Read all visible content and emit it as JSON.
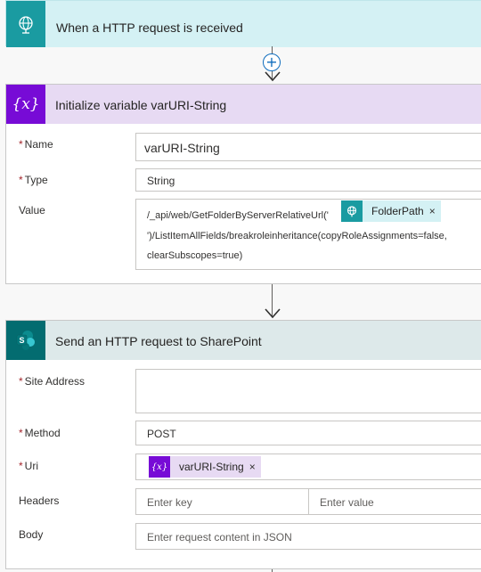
{
  "trigger": {
    "title": "When a HTTP request is received",
    "icon": "globe-request-icon",
    "color": "#1a9ba1"
  },
  "connector_add": {
    "icon": "plus-circle-icon",
    "symbol": "+"
  },
  "init_variable": {
    "title": "Initialize variable varURI-String",
    "icon": "variable-icon",
    "icon_text": "{x}",
    "color": "#770bd6",
    "fields": {
      "name_label": "Name",
      "name_value": "varURI-String",
      "type_label": "Type",
      "type_value": "String",
      "value_label": "Value",
      "value_line1": "/_api/web/GetFolderByServerRelativeUrl('",
      "value_token": "FolderPath",
      "value_line2": "')/ListItemAllFields/breakroleinheritance(copyRoleAssignments=false,",
      "value_line3": "clearSubscopes=true)"
    },
    "required_marker": "*"
  },
  "sharepoint": {
    "title": "Send an HTTP request to SharePoint",
    "icon": "sharepoint-icon",
    "color": "#036c70",
    "fields": {
      "site_label": "Site Address",
      "site_value": "",
      "method_label": "Method",
      "method_value": "POST",
      "uri_label": "Uri",
      "uri_token": "varURI-String",
      "headers_label": "Headers",
      "headers_key_placeholder": "Enter key",
      "headers_value_placeholder": "Enter value",
      "body_label": "Body",
      "body_placeholder": "Enter request content in JSON"
    },
    "required_marker": "*"
  },
  "token_close": "×"
}
